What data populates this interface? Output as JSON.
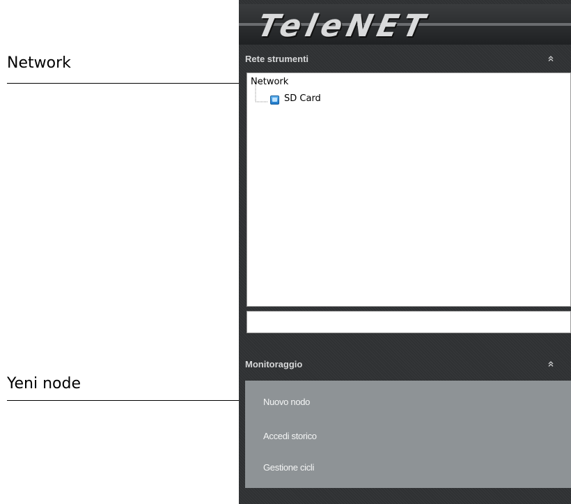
{
  "callouts": {
    "network_label": "Network",
    "new_node_label": "Yeni node"
  },
  "app": {
    "logo": "TeleNET",
    "network_section": {
      "title": "Rete strumenti",
      "collapse_icon": "double-chevron-up-icon",
      "tree": [
        {
          "label": "Network",
          "icon": null
        },
        {
          "label": "SD Card",
          "icon": "sd-card-icon"
        }
      ],
      "input_value": ""
    },
    "monitoring_section": {
      "title": "Monitoraggio",
      "collapse_icon": "double-chevron-up-icon",
      "items": [
        "Nuovo nodo",
        "Accedi storico",
        "Gestione cicli"
      ]
    }
  },
  "colors": {
    "panel_bg": "#2f3133",
    "menu_bg": "#8e9396",
    "header_text": "#d7d8d9",
    "menu_text": "#f4f5f5",
    "sd_icon": "#2a8ad8"
  }
}
